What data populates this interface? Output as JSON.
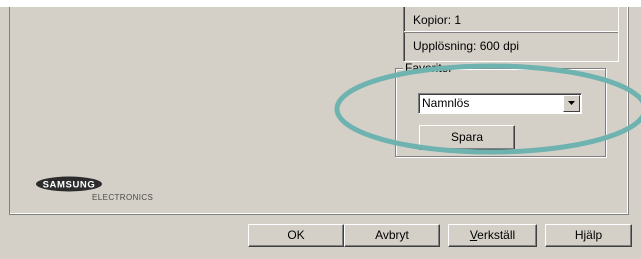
{
  "info": {
    "copies": "Kopior: 1",
    "resolution": "Upplösning: 600 dpi"
  },
  "favorites": {
    "legend": "Favoriter",
    "selected": "Namnlös",
    "save_label": "Spara"
  },
  "logo": {
    "brand": "SAMSUNG",
    "subtitle": "ELECTRONICS"
  },
  "buttons": {
    "ok": "OK",
    "cancel": "Avbryt",
    "apply_underlined": "V",
    "apply_rest": "erkställ",
    "help": "Hjälp"
  },
  "colors": {
    "highlight_ring": "#6fb3b0",
    "dialog_bg": "#d4d0c8"
  },
  "icons": {
    "combo_arrow": "chevron-down-icon"
  }
}
